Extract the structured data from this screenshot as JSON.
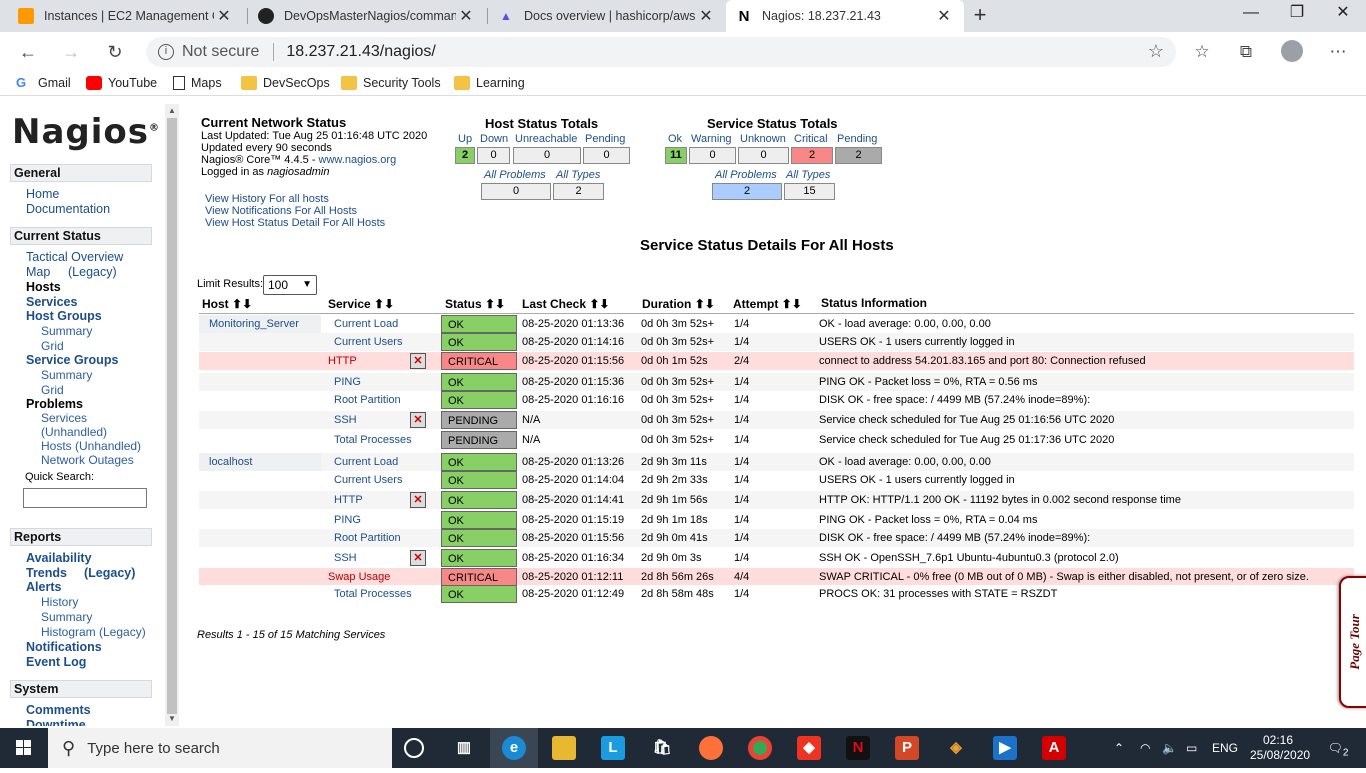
{
  "browser": {
    "tabs": [
      {
        "title": "Instances | EC2 Management Co",
        "icon": "aws-icon"
      },
      {
        "title": "DevOpsMasterNagios/command",
        "icon": "github-icon"
      },
      {
        "title": "Docs overview | hashicorp/aws |",
        "icon": "terraform-icon"
      },
      {
        "title": "Nagios: 18.237.21.43",
        "icon": "nagios-icon"
      }
    ],
    "not_secure": "Not secure",
    "url": "18.237.21.43/nagios/",
    "bookmarks": [
      "Gmail",
      "YouTube",
      "Maps",
      "DevSecOps",
      "Security Tools",
      "Learning"
    ]
  },
  "sidebar": {
    "logo": "Nagios",
    "general": {
      "title": "General",
      "items": [
        "Home",
        "Documentation"
      ]
    },
    "current_status": {
      "title": "Current Status",
      "items": [
        "Tactical Overview",
        "Map",
        "(Legacy)",
        "Hosts",
        "Services",
        "Host Groups",
        "Summary",
        "Grid",
        "Service Groups",
        "Summary",
        "Grid",
        "Problems",
        "Services",
        "(Unhandled)",
        "Hosts (Unhandled)",
        "Network Outages"
      ]
    },
    "quick_search": "Quick Search:",
    "reports": {
      "title": "Reports",
      "items": [
        "Availability",
        "Trends",
        "(Legacy)",
        "Alerts",
        "History",
        "Summary",
        "Histogram (Legacy)",
        "Notifications",
        "Event Log"
      ]
    },
    "system": {
      "title": "System",
      "items": [
        "Comments",
        "Downtime"
      ]
    }
  },
  "network_status": {
    "title": "Current Network Status",
    "last_updated": "Last Updated: Tue Aug 25 01:16:48 UTC 2020",
    "interval": "Updated every 90 seconds",
    "core_prefix": "Nagios® Core™ 4.4.5 - ",
    "core_link": "www.nagios.org",
    "logged_prefix": "Logged in as ",
    "user": "nagiosadmin",
    "links": [
      "View History For all hosts",
      "View Notifications For All Hosts",
      "View Host Status Detail For All Hosts"
    ]
  },
  "host_totals": {
    "title": "Host Status Totals",
    "labels": [
      "Up",
      "Down",
      "Unreachable",
      "Pending"
    ],
    "values": [
      "2",
      "0",
      "0",
      "0"
    ],
    "sub_labels": [
      "All Problems",
      "All Types"
    ],
    "sub_values": [
      "0",
      "2"
    ]
  },
  "service_totals": {
    "title": "Service Status Totals",
    "labels": [
      "Ok",
      "Warning",
      "Unknown",
      "Critical",
      "Pending"
    ],
    "values": [
      "11",
      "0",
      "0",
      "2",
      "2"
    ],
    "sub_labels": [
      "All Problems",
      "All Types"
    ],
    "sub_values": [
      "2",
      "15"
    ]
  },
  "details": {
    "title": "Service Status Details For All Hosts",
    "limit_label": "Limit Results:",
    "limit_value": "100",
    "columns": [
      "Host",
      "Service",
      "Status",
      "Last Check",
      "Duration",
      "Attempt",
      "Status Information"
    ],
    "rows": [
      {
        "host": "Monitoring_Server",
        "service": "Current Load",
        "status": "OK",
        "check": "08-25-2020 01:13:36",
        "duration": "0d 0h 3m 52s+",
        "attempt": "1/4",
        "info": "OK - load average: 0.00, 0.00, 0.00"
      },
      {
        "host": "",
        "service": "Current Users",
        "status": "OK",
        "check": "08-25-2020 01:14:16",
        "duration": "0d 0h 3m 52s+",
        "attempt": "1/4",
        "info": "USERS OK - 1 users currently logged in"
      },
      {
        "host": "",
        "service": "HTTP",
        "status": "CRITICAL",
        "check": "08-25-2020 01:15:56",
        "duration": "0d 0h 1m 52s",
        "attempt": "2/4",
        "info": "connect to address 54.201.83.165 and port 80: Connection refused"
      },
      {
        "host": "",
        "service": "PING",
        "status": "OK",
        "check": "08-25-2020 01:15:36",
        "duration": "0d 0h 3m 52s+",
        "attempt": "1/4",
        "info": "PING OK - Packet loss = 0%, RTA = 0.56 ms"
      },
      {
        "host": "",
        "service": "Root Partition",
        "status": "OK",
        "check": "08-25-2020 01:16:16",
        "duration": "0d 0h 3m 52s+",
        "attempt": "1/4",
        "info": "DISK OK - free space: / 4499 MB (57.24% inode=89%):"
      },
      {
        "host": "",
        "service": "SSH",
        "status": "PENDING",
        "check": "N/A",
        "duration": "0d 0h 3m 52s+",
        "attempt": "1/4",
        "info": "Service check scheduled for Tue Aug 25 01:16:56 UTC 2020"
      },
      {
        "host": "",
        "service": "Total Processes",
        "status": "PENDING",
        "check": "N/A",
        "duration": "0d 0h 3m 52s+",
        "attempt": "1/4",
        "info": "Service check scheduled for Tue Aug 25 01:17:36 UTC 2020"
      },
      {
        "host": "localhost",
        "service": "Current Load",
        "status": "OK",
        "check": "08-25-2020 01:13:26",
        "duration": "2d 9h 3m 11s",
        "attempt": "1/4",
        "info": "OK - load average: 0.00, 0.00, 0.00"
      },
      {
        "host": "",
        "service": "Current Users",
        "status": "OK",
        "check": "08-25-2020 01:14:04",
        "duration": "2d 9h 2m 33s",
        "attempt": "1/4",
        "info": "USERS OK - 1 users currently logged in"
      },
      {
        "host": "",
        "service": "HTTP",
        "status": "OK",
        "check": "08-25-2020 01:14:41",
        "duration": "2d 9h 1m 56s",
        "attempt": "1/4",
        "info": "HTTP OK: HTTP/1.1 200 OK - 11192 bytes in 0.002 second response time"
      },
      {
        "host": "",
        "service": "PING",
        "status": "OK",
        "check": "08-25-2020 01:15:19",
        "duration": "2d 9h 1m 18s",
        "attempt": "1/4",
        "info": "PING OK - Packet loss = 0%, RTA = 0.04 ms"
      },
      {
        "host": "",
        "service": "Root Partition",
        "status": "OK",
        "check": "08-25-2020 01:15:56",
        "duration": "2d 9h 0m 41s",
        "attempt": "1/4",
        "info": "DISK OK - free space: / 4499 MB (57.24% inode=89%):"
      },
      {
        "host": "",
        "service": "SSH",
        "status": "OK",
        "check": "08-25-2020 01:16:34",
        "duration": "2d 9h 0m 3s",
        "attempt": "1/4",
        "info": "SSH OK - OpenSSH_7.6p1 Ubuntu-4ubuntu0.3 (protocol 2.0)"
      },
      {
        "host": "",
        "service": "Swap Usage",
        "status": "CRITICAL",
        "check": "08-25-2020 01:12:11",
        "duration": "2d 8h 56m 26s",
        "attempt": "4/4",
        "info": "SWAP CRITICAL - 0% free (0 MB out of 0 MB) - Swap is either disabled, not present, or of zero size."
      },
      {
        "host": "",
        "service": "Total Processes",
        "status": "OK",
        "check": "08-25-2020 01:12:49",
        "duration": "2d 8h 58m 48s",
        "attempt": "1/4",
        "info": "PROCS OK: 31 processes with STATE = RSZDT"
      }
    ],
    "results": "Results 1 - 15 of 15 Matching Services"
  },
  "page_tour": "Page Tour",
  "taskbar": {
    "search_placeholder": "Type here to search",
    "lang": "ENG",
    "time": "02:16",
    "date": "25/08/2020",
    "notif_count": "2"
  }
}
